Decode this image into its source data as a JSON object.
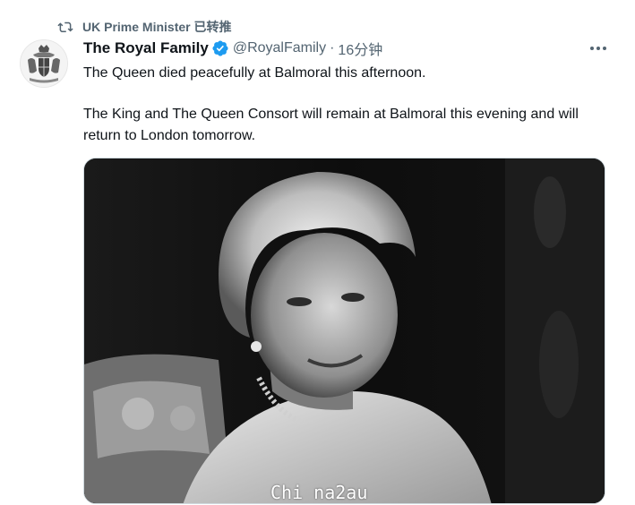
{
  "retweet": {
    "icon": "retweet-icon",
    "text": "UK Prime Minister 已转推"
  },
  "tweet": {
    "author": {
      "display_name": "The Royal Family",
      "handle": "@RoyalFamily",
      "verified": true,
      "avatar": "royal-coat-of-arms"
    },
    "time": "16分钟",
    "separator": "·",
    "lines": [
      "The Queen died peacefully at Balmoral this afternoon.",
      "The King and The Queen Consort will remain at Balmoral this evening and will return to London tomorrow."
    ],
    "media": {
      "description_icon": "photo",
      "watermark": "Chi na2au"
    }
  },
  "colors": {
    "text": "#0f1419",
    "secondary": "#536471",
    "verified": "#1d9bf0"
  }
}
